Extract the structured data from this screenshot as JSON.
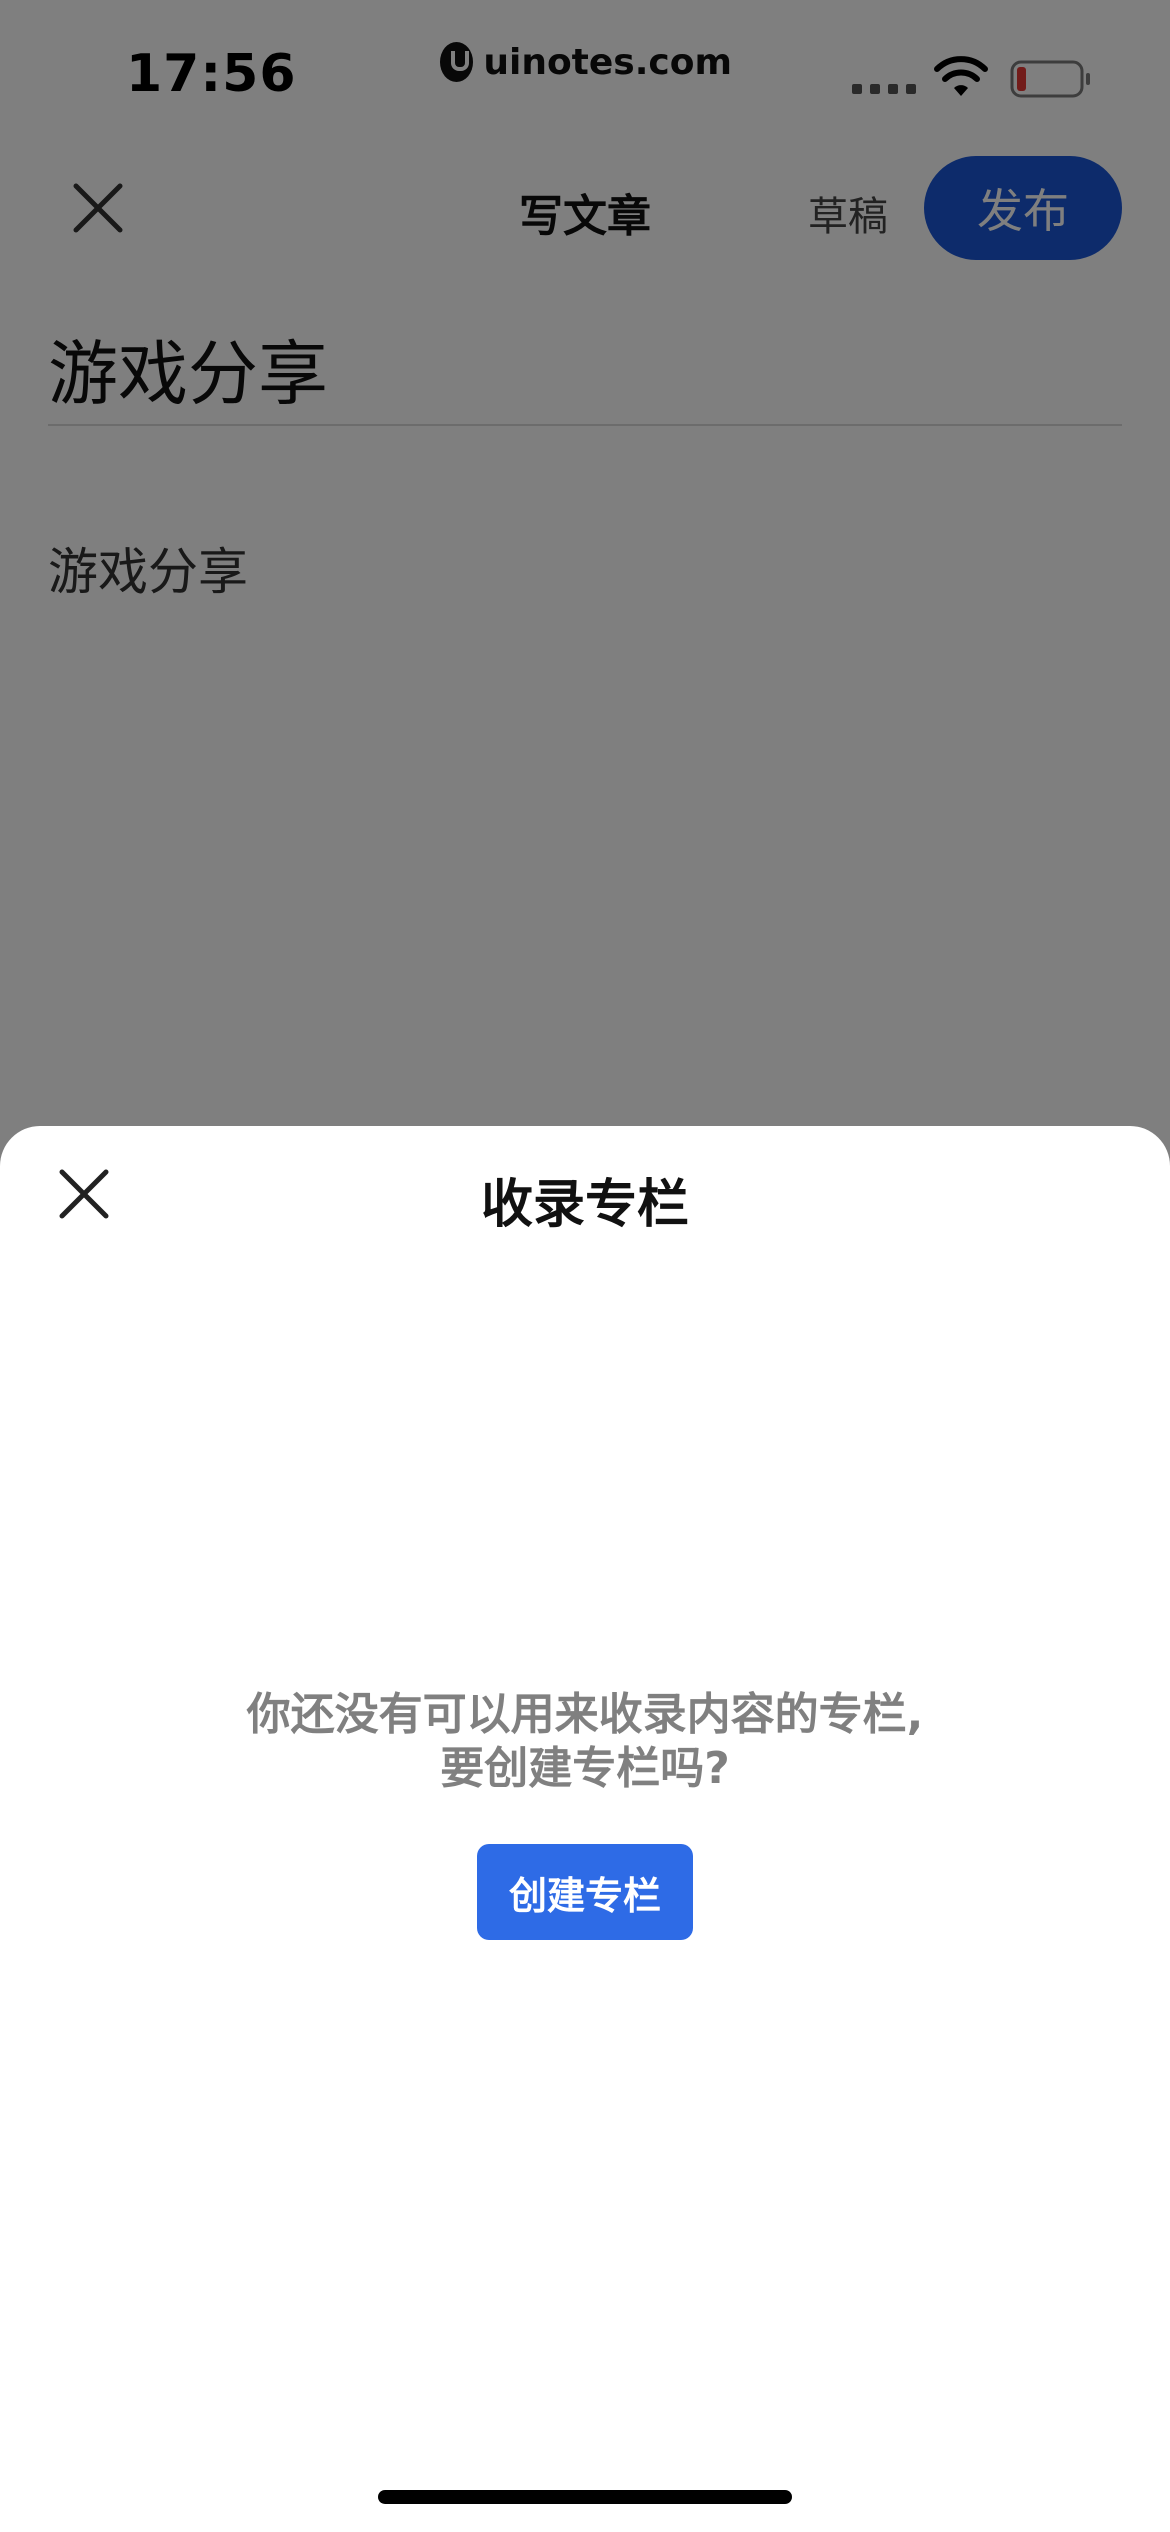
{
  "status_bar": {
    "time": "17:56",
    "watermark": "uinotes.com"
  },
  "nav": {
    "title": "写文章",
    "draft_label": "草稿",
    "publish_label": "发布"
  },
  "article": {
    "title": "游戏分享",
    "body": "游戏分享"
  },
  "sheet": {
    "title": "收录专栏",
    "empty_message_line1": "你还没有可以用来收录内容的专栏,",
    "empty_message_line2": "要创建专栏吗?",
    "create_label": "创建专栏"
  },
  "colors": {
    "publish_button": "#1A56D6",
    "create_button": "#2E6BE6",
    "battery_low": "#E53935"
  },
  "icons": [
    "close-icon",
    "wifi-icon",
    "battery-icon",
    "signal-icon",
    "uinotes-logo-icon"
  ]
}
